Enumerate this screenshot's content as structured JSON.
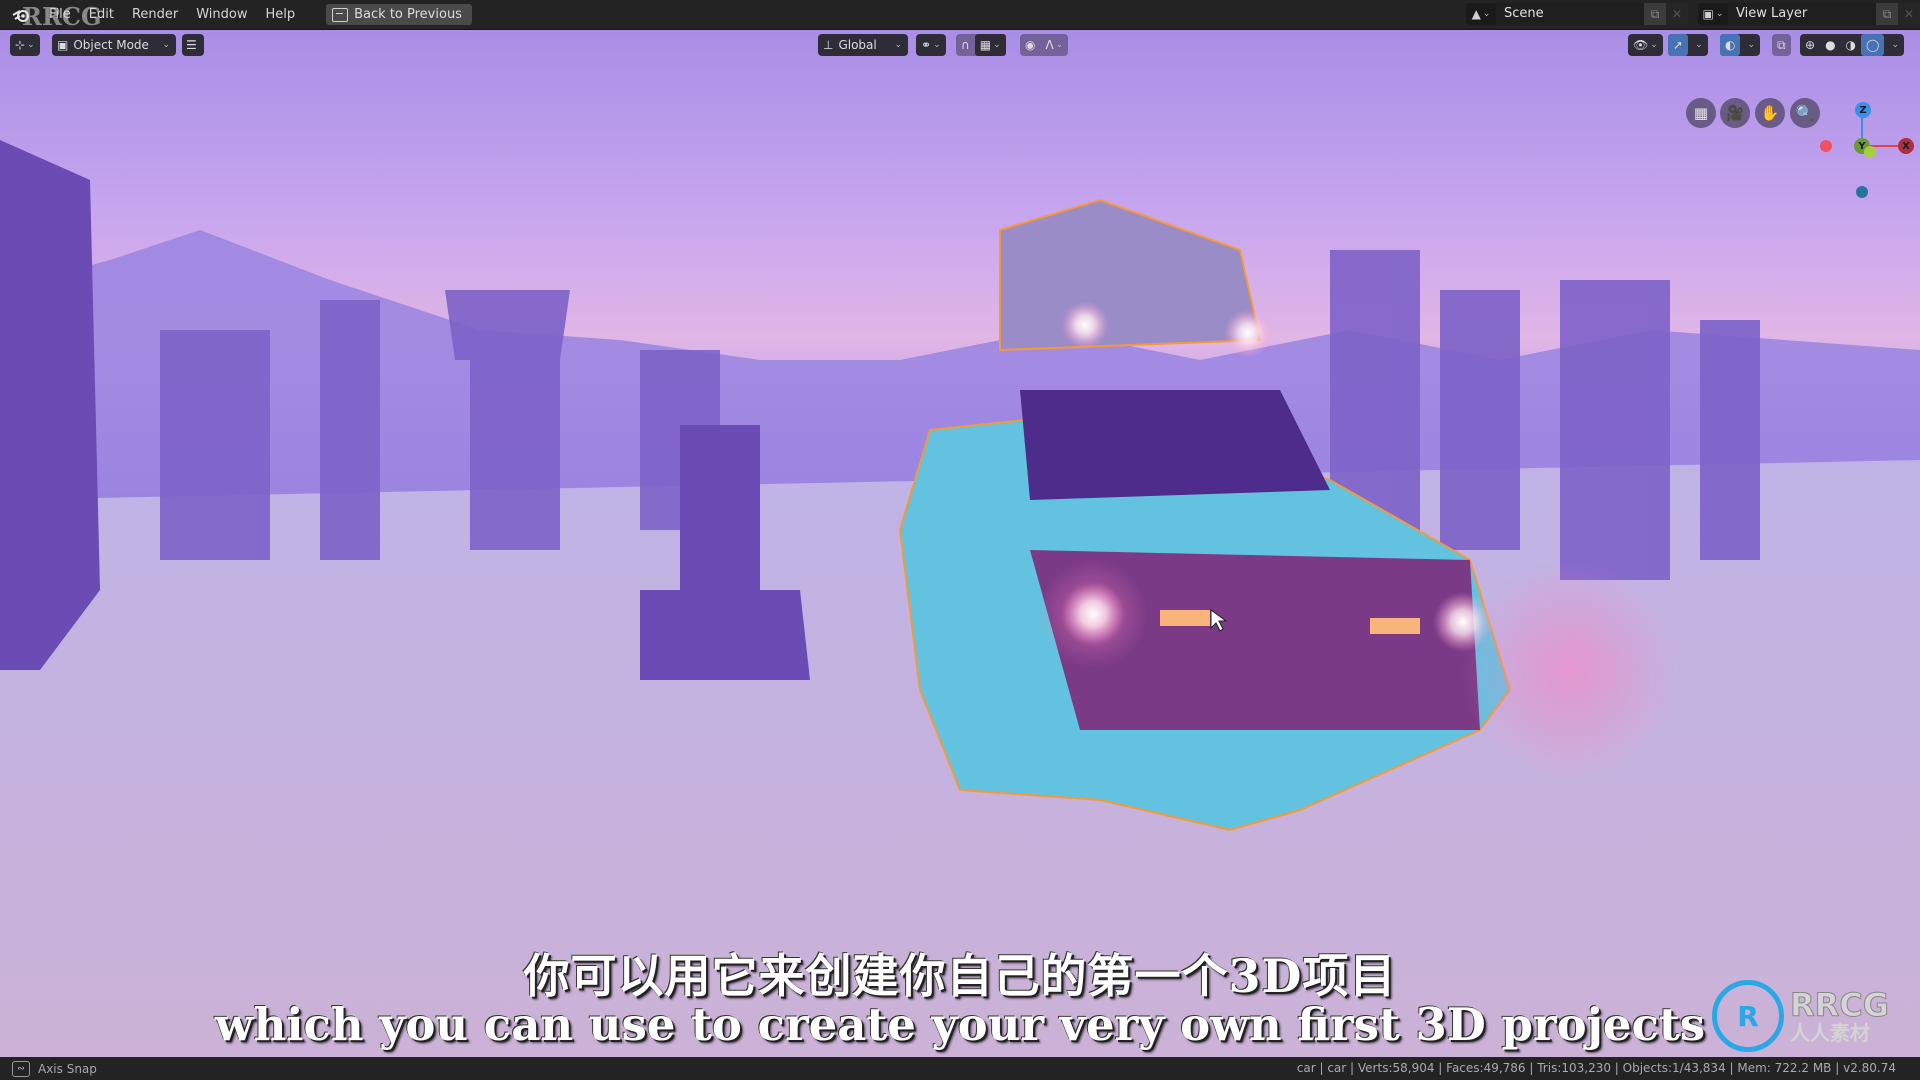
{
  "topbar": {
    "logo_icon": "blender-logo-icon",
    "menu": [
      "File",
      "Edit",
      "Render",
      "Window",
      "Help"
    ],
    "back_to_previous": "Back to Previous",
    "scene": {
      "icon": "scene-icon",
      "value": "Scene"
    },
    "view_layer": {
      "icon": "view-layer-icon",
      "value": "View Layer"
    }
  },
  "viewport_header": {
    "editor_type_icon": "3d-viewport-icon",
    "mode": "Object Mode",
    "menu_icon": "hamburger-menu-icon",
    "transform_orientation": "Global",
    "pivot_icon": "pivot-point-icon",
    "snap_icon": "snap-magnet-icon",
    "snap_target_icon": "snap-increment-icon",
    "proportional_icon": "proportional-edit-icon",
    "falloff_icon": "falloff-curve-icon",
    "right_icons": [
      "visibility-eye-icon",
      "gizmo-icon",
      "overlay-icon",
      "xray-icon",
      "wireframe-shading-icon",
      "solid-shading-icon",
      "material-preview-icon",
      "rendered-shading-icon"
    ]
  },
  "navigation": {
    "buttons": [
      "perspective-grid-icon",
      "camera-view-icon",
      "pan-hand-icon",
      "zoom-magnifier-icon"
    ],
    "gizmo_axes": [
      "Z",
      "Y",
      "X"
    ]
  },
  "subtitles": {
    "chinese": "你可以用它来创建你自己的第一个3D项目",
    "english": "which you can use to create your very own first 3D projects"
  },
  "watermark": {
    "top_left": "RRCG",
    "corner_logo": "RRCG",
    "corner_cn": "人人素材"
  },
  "statusbar": {
    "left_label": "Axis Snap",
    "stats": "car | car | Verts:58,904 | Faces:49,786 | Tris:103,230 | Objects:1/43,834 | Mem: 722.2 MB | v2.80.74"
  },
  "colors": {
    "selection_outline": "#f39a3a",
    "active_button": "#4772b3",
    "axis_x": "#e44050",
    "axis_y": "#7fbf3a",
    "axis_z": "#3a8fe8"
  }
}
